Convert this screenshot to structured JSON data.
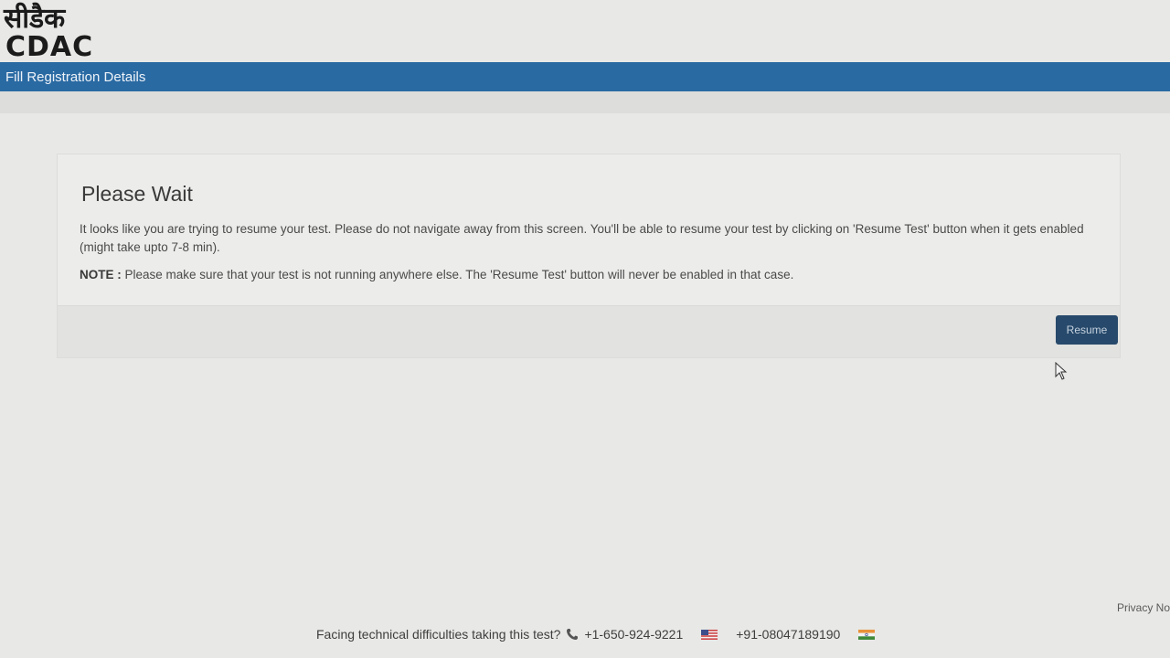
{
  "logo": {
    "hindi": "सीडैक",
    "latin": "CDAC"
  },
  "header": {
    "title": "Fill Registration Details"
  },
  "dialog": {
    "title": "Please Wait",
    "message": "It looks like you are trying to resume your test. Please do not navigate away from this screen. You'll be able to resume your test by clicking on 'Resume Test' button when it gets enabled (might take upto 7-8 min).",
    "note_label": "NOTE :",
    "note_text": " Please make sure that your test is not running anywhere else. The 'Resume Test' button will never be enabled in that case.",
    "resume_label": "Resume"
  },
  "footer": {
    "help_text": "Facing technical difficulties taking this test?",
    "phone_us": "+1-650-924-9221",
    "phone_in": "+91-08047189190",
    "privacy": "Privacy No"
  },
  "colors": {
    "header_bar": "#2a6aa3",
    "resume_button": "#27496b"
  }
}
